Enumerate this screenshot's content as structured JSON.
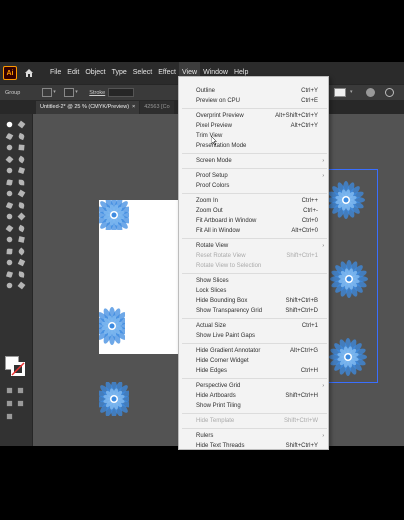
{
  "menubar": {
    "app_logo": "Ai",
    "items": [
      "File",
      "Edit",
      "Object",
      "Type",
      "Select",
      "Effect",
      "View",
      "Window",
      "Help"
    ],
    "active_index": 6
  },
  "controlbar": {
    "selection_label": "Group",
    "stroke_label": "Stroke",
    "fill_color": "#ffffff",
    "stroke_color": "#333333"
  },
  "tabs": [
    {
      "label": "Untitled-2* @ 25 % (CMYK/Preview)",
      "close": "×"
    },
    {
      "label": "42563 [Co",
      "close": ""
    }
  ],
  "view_menu": {
    "items": [
      {
        "label": "Outline",
        "shortcut": "Ctrl+Y"
      },
      {
        "label": "Preview on CPU",
        "shortcut": "Ctrl+E"
      },
      {
        "sep": true
      },
      {
        "label": "Overprint Preview",
        "shortcut": "Alt+Shift+Ctrl+Y"
      },
      {
        "label": "Pixel Preview",
        "shortcut": "Alt+Ctrl+Y"
      },
      {
        "label": "Trim View",
        "shortcut": "",
        "hover": true
      },
      {
        "label": "Presentation Mode",
        "shortcut": ""
      },
      {
        "sep": true
      },
      {
        "label": "Screen Mode",
        "shortcut": "",
        "submenu": true
      },
      {
        "sep": true
      },
      {
        "label": "Proof Setup",
        "shortcut": "",
        "submenu": true
      },
      {
        "label": "Proof Colors",
        "shortcut": ""
      },
      {
        "sep": true
      },
      {
        "label": "Zoom In",
        "shortcut": "Ctrl++"
      },
      {
        "label": "Zoom Out",
        "shortcut": "Ctrl+-"
      },
      {
        "label": "Fit Artboard in Window",
        "shortcut": "Ctrl+0"
      },
      {
        "label": "Fit All in Window",
        "shortcut": "Alt+Ctrl+0"
      },
      {
        "sep": true
      },
      {
        "label": "Rotate View",
        "shortcut": "",
        "submenu": true
      },
      {
        "label": "Reset Rotate View",
        "shortcut": "Shift+Ctrl+1",
        "disabled": true
      },
      {
        "label": "Rotate View to Selection",
        "shortcut": "",
        "disabled": true
      },
      {
        "sep": true
      },
      {
        "label": "Show Slices",
        "shortcut": ""
      },
      {
        "label": "Lock Slices",
        "shortcut": ""
      },
      {
        "label": "Hide Bounding Box",
        "shortcut": "Shift+Ctrl+B"
      },
      {
        "label": "Show Transparency Grid",
        "shortcut": "Shift+Ctrl+D"
      },
      {
        "sep": true
      },
      {
        "label": "Actual Size",
        "shortcut": "Ctrl+1"
      },
      {
        "label": "Show Live Paint Gaps",
        "shortcut": ""
      },
      {
        "sep": true
      },
      {
        "label": "Hide Gradient Annotator",
        "shortcut": "Alt+Ctrl+G"
      },
      {
        "label": "Hide Corner Widget",
        "shortcut": ""
      },
      {
        "label": "Hide Edges",
        "shortcut": "Ctrl+H"
      },
      {
        "sep": true
      },
      {
        "label": "Perspective Grid",
        "shortcut": "",
        "submenu": true
      },
      {
        "label": "Hide Artboards",
        "shortcut": "Shift+Ctrl+H"
      },
      {
        "label": "Show Print Tiling",
        "shortcut": ""
      },
      {
        "sep": true
      },
      {
        "label": "Hide Template",
        "shortcut": "Shift+Ctrl+W",
        "disabled": true
      },
      {
        "sep": true
      },
      {
        "label": "Rulers",
        "shortcut": "",
        "submenu": true
      },
      {
        "label": "Hide Text Threads",
        "shortcut": "Shift+Ctrl+Y"
      }
    ]
  },
  "colors": {
    "menubar_bg": "#2b2b2b",
    "canvas_bg": "#535353",
    "artwork_blue": "#3d8be0",
    "selection_blue": "#3a6fff"
  }
}
